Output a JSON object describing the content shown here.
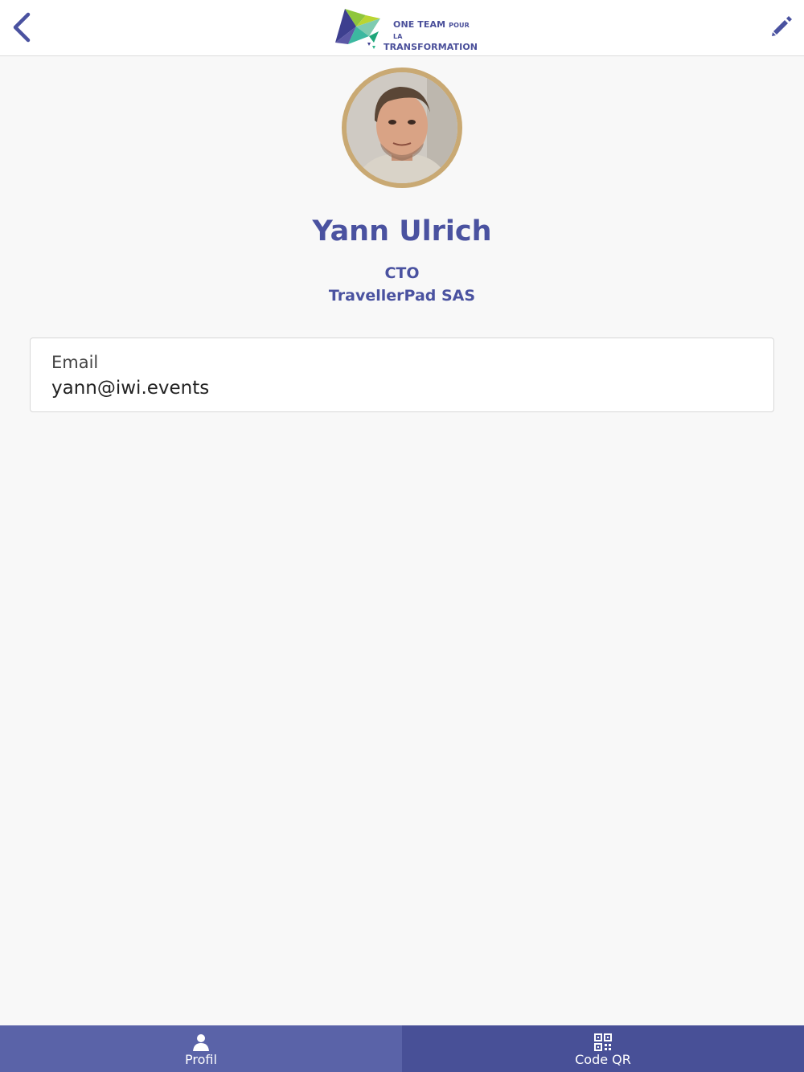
{
  "header": {
    "logo_line1": "ONE TEAM",
    "logo_line1_small": "POUR LA",
    "logo_line2": "TRANSFORMATION"
  },
  "profile": {
    "name": "Yann Ulrich",
    "role": "CTO",
    "company": "TravellerPad SAS"
  },
  "contact": {
    "email_label": "Email",
    "email_value": "yann@iwi.events"
  },
  "tabs": [
    {
      "label": "Profil",
      "icon": "person-icon",
      "selected": true
    },
    {
      "label": "Code QR",
      "icon": "qr-code-icon",
      "selected": false
    }
  ],
  "colors": {
    "accent": "#4a52a0",
    "avatar_ring": "#c9a973",
    "tab_active": "#5a63a8",
    "tab_inactive": "#485097",
    "background": "#f8f8f8"
  }
}
